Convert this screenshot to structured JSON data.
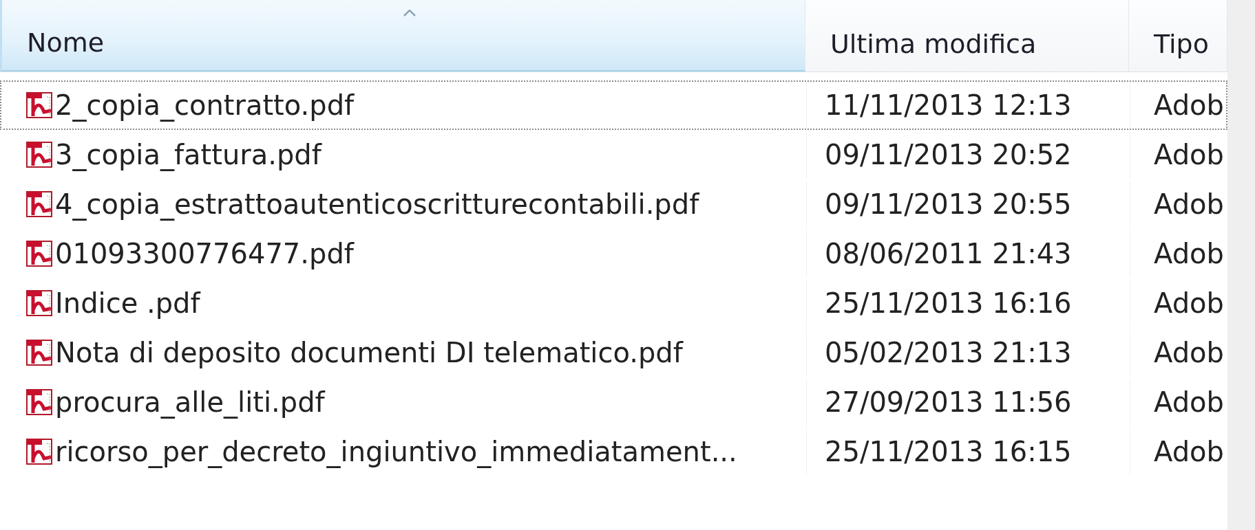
{
  "columns": [
    {
      "label": "Nome",
      "sorted": true
    },
    {
      "label": "Ultima modifica",
      "sorted": false
    },
    {
      "label": "Tipo",
      "sorted": false
    }
  ],
  "files": [
    {
      "name": "2_copia_contratto.pdf",
      "modified": "11/11/2013 12:13",
      "type": "Adob",
      "focused": true
    },
    {
      "name": "3_copia_fattura.pdf",
      "modified": "09/11/2013 20:52",
      "type": "Adob",
      "focused": false
    },
    {
      "name": "4_copia_estrattoautenticoscritturecontabili.pdf",
      "modified": "09/11/2013 20:55",
      "type": "Adob",
      "focused": false
    },
    {
      "name": "01093300776477.pdf",
      "modified": "08/06/2011 21:43",
      "type": "Adob",
      "focused": false
    },
    {
      "name": "Indice .pdf",
      "modified": "25/11/2013 16:16",
      "type": "Adob",
      "focused": false
    },
    {
      "name": "Nota di deposito documenti DI telematico.pdf",
      "modified": "05/02/2013 21:13",
      "type": "Adob",
      "focused": false
    },
    {
      "name": "procura_alle_liti.pdf",
      "modified": "27/09/2013 11:56",
      "type": "Adob",
      "focused": false
    },
    {
      "name": "ricorso_per_decreto_ingiuntivo_immediatament...",
      "modified": "25/11/2013 16:15",
      "type": "Adob",
      "focused": false
    }
  ]
}
